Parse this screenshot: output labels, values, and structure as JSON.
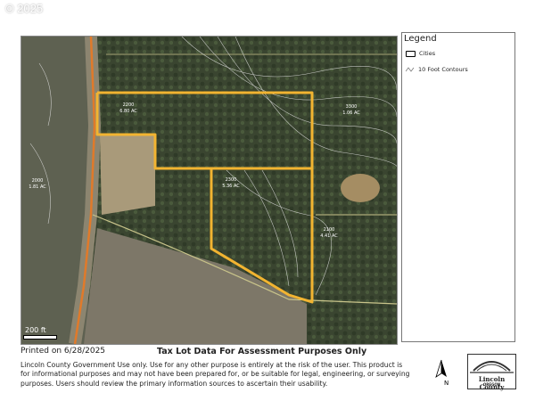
{
  "watermark": "© 2025",
  "legend": {
    "title": "Legend",
    "items": [
      {
        "label": "Cities",
        "icon": "city-boundary-icon"
      },
      {
        "label": "10 Foot Contours",
        "icon": "contour-line-icon"
      }
    ]
  },
  "map": {
    "scale_label": "200 ft",
    "lot_labels": [
      {
        "id": "2200",
        "area": "6.80 AC"
      },
      {
        "id": "2300",
        "area": "5.36 AC"
      },
      {
        "id": "2100",
        "area": "4.41 AC"
      },
      {
        "id": "2000",
        "area": "1.81 AC"
      },
      {
        "id": "3300",
        "area": "1.06 AC"
      }
    ],
    "colors": {
      "aerial": "#3f4a34",
      "tax_lot_highlight": "#f2b431",
      "road": "#c8c38a",
      "contour": "#e6e6e6"
    }
  },
  "footer": {
    "printed": "Printed on 6/28/2025",
    "title": "Tax Lot Data For Assessment Purposes Only",
    "disclaimer": "Lincoln County Government Use only. Use for any other purpose is entirely at the risk of the user. This product is for informational purposes and may not have been prepared for, or be suitable for legal, engineering, or surveying purposes. Users should review the primary information sources to ascertain their usability.",
    "north_label": "N",
    "logo_name": "Lincoln County",
    "logo_sub": "OREGON"
  }
}
